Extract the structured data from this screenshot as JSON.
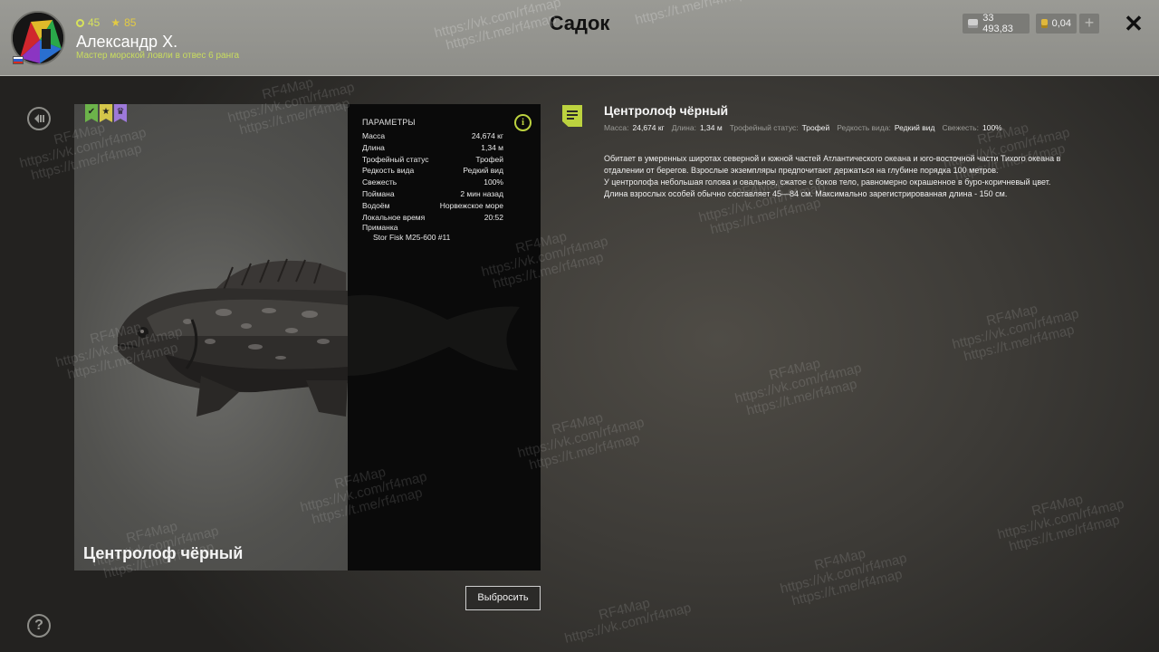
{
  "header": {
    "title": "Садок",
    "player": {
      "level": "45",
      "rank": "85",
      "name": "Александр Х.",
      "title": "Мастер морской ловли в отвес 6 ранга"
    },
    "currency": {
      "silver": "33 493,83",
      "gold": "0,04"
    },
    "plus_label": "+",
    "close_label": "✕"
  },
  "fish": {
    "name": "Центролоф чёрный",
    "badges": [
      "check",
      "star",
      "crown"
    ]
  },
  "params": {
    "header": "ПАРАМЕТРЫ",
    "rows": [
      {
        "label": "Масса",
        "value": "24,674 кг"
      },
      {
        "label": "Длина",
        "value": "1,34 м"
      },
      {
        "label": "Трофейный статус",
        "value": "Трофей"
      },
      {
        "label": "Редкость вида",
        "value": "Редкий вид"
      },
      {
        "label": "Свежесть",
        "value": "100%"
      },
      {
        "label": "Поймана",
        "value": "2 мин назад"
      },
      {
        "label": "Водоём",
        "value": "Норвежское море"
      },
      {
        "label": "Локальное время",
        "value": "20:52"
      }
    ],
    "bait_label": "Приманка",
    "bait_value": "Stor Fisk M25-600 #11"
  },
  "release_button": "Выбросить",
  "description": {
    "title": "Центролоф чёрный",
    "meta": [
      {
        "label": "Масса:",
        "value": "24,674 кг"
      },
      {
        "label": "Длина:",
        "value": "1,34 м"
      },
      {
        "label": "Трофейный статус:",
        "value": "Трофей"
      },
      {
        "label": "Редкость вида:",
        "value": "Редкий вид"
      },
      {
        "label": "Свежесть:",
        "value": "100%"
      }
    ],
    "lines": [
      "Обитает в умеренных широтах северной и южной частей Атлантического океана и юго-восточной части Тихого океана в",
      "отдалении от берегов. Взрослые экземпляры предпочитают держаться на глубине порядка 100 метров.",
      "У центролофа небольшая голова и овальное, сжатое с боков тело, равномерно окрашенное в буро-коричневый цвет.",
      "Длина взрослых особей обычно составляет 45—84 см. Максимально зарегистрированная длина - 150 см."
    ]
  },
  "help_label": "?",
  "watermark": {
    "brand": "RF4Map",
    "vk": "https://vk.com/rf4map",
    "tg": "https://t.me/rf4map"
  },
  "colors": {
    "accent": "#bcd23f",
    "level": "#d7e25a",
    "rank": "#e3cb43",
    "badge_green": "#6cb34a",
    "badge_yellow": "#d4c64a",
    "badge_purple": "#9d79d9"
  },
  "icons": {
    "back": "back-circle-icon",
    "help": "help-icon",
    "info": "info-icon",
    "note": "note-icon",
    "silver": "silver-coin-icon",
    "gold": "gold-coin-icon"
  }
}
